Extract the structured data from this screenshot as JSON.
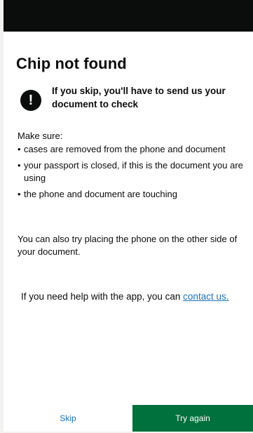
{
  "colors": {
    "status_bar": "#0b0c0c",
    "text": "#0b0c0c",
    "link": "#1d70b8",
    "primary_button": "#00703c",
    "background": "#ffffff"
  },
  "page": {
    "title": "Chip not found"
  },
  "warning": {
    "icon": "exclamation-icon",
    "icon_glyph": "!",
    "text": "If you skip, you'll have to send us your document to check"
  },
  "instructions": {
    "intro": "Make sure:",
    "bullets": [
      "cases are removed from the phone and document",
      "your passport is closed, if this is the document you are using",
      "the phone and document are touching"
    ],
    "other_side": "You can also try placing the phone on the other side of your document."
  },
  "help": {
    "prefix": "If you need help with the app, you can ",
    "link_text": "contact us."
  },
  "footer": {
    "skip_label": "Skip",
    "try_again_label": "Try again"
  }
}
